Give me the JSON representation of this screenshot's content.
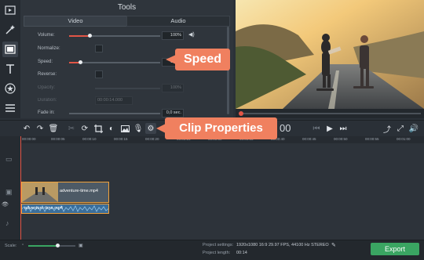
{
  "tools": {
    "title": "Tools",
    "tabs": [
      "Video",
      "Audio"
    ],
    "rows": {
      "volume": {
        "label": "Volume:",
        "value": "100%"
      },
      "normalize": {
        "label": "Normalize:"
      },
      "speed": {
        "label": "Speed:",
        "value": "100%"
      },
      "reverse": {
        "label": "Reverse:"
      },
      "opacity": {
        "label": "Opacity:",
        "value": "100%"
      },
      "duration": {
        "label": "Duration:",
        "value": "00:00:14.000"
      },
      "fade_in": {
        "label": "Fade in:",
        "value": "0,0 sec."
      }
    }
  },
  "callouts": {
    "speed": "Speed",
    "clip_properties": "Clip Properties"
  },
  "preview": {
    "timecode": "00"
  },
  "ruler": {
    "ticks": [
      "00:00:00",
      "00:00:05",
      "00:00:10",
      "00:00:15",
      "00:00:20",
      "00:00:25",
      "00:00:30",
      "00:00:35",
      "00:00:40",
      "00:00:45",
      "00:00:50",
      "00:00:55",
      "00:01:00"
    ]
  },
  "clips": {
    "video": "adventure-time.mp4",
    "audio": "adventure-time.mp4"
  },
  "bottom": {
    "scale_label": "Scale:",
    "project_settings_label": "Project settings:",
    "project_settings_value": "1920x1080 16:9 29.97 FPS, 44100 Hz STEREO",
    "project_length_label": "Project length:",
    "project_length_value": "00:14",
    "export": "Export"
  },
  "colors": {
    "accent": "#e25546",
    "callout": "#f0805f",
    "export": "#3aa562",
    "clip_border": "#f0a23c"
  }
}
